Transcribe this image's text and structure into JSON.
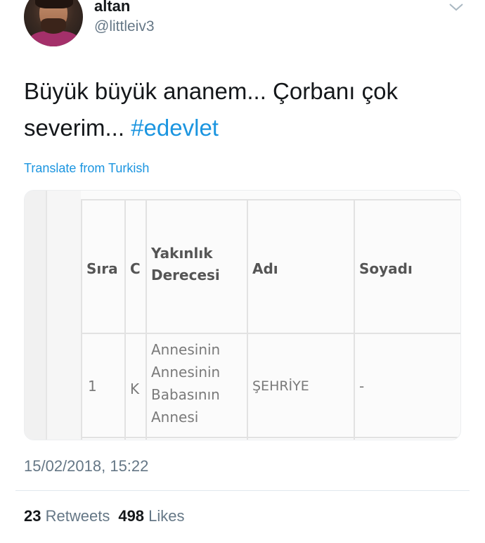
{
  "user": {
    "display_name": "altan",
    "handle": "@littleiv3"
  },
  "tweet": {
    "text": "Büyük büyük ananem... Çorbanı çok severim... ",
    "hashtag": "#edevlet",
    "translate_label": "Translate from Turkish",
    "timestamp": "15/02/2018, 15:22"
  },
  "media": {
    "headers": [
      "Sıra",
      "C",
      "Yakınlık Derecesi",
      "Adı",
      "Soyadı"
    ],
    "row": [
      "1",
      "K",
      "Annesinin Annesinin Babasının Annesi",
      "ŞEHRİYE",
      "-"
    ]
  },
  "stats": {
    "retweets_count": "23",
    "retweets_label": "Retweets",
    "likes_count": "498",
    "likes_label": "Likes"
  },
  "icons": {
    "menu": "chevron-down-icon"
  },
  "colors": {
    "link": "#1b95e0",
    "secondary_text": "#657786",
    "primary_text": "#14171a"
  }
}
